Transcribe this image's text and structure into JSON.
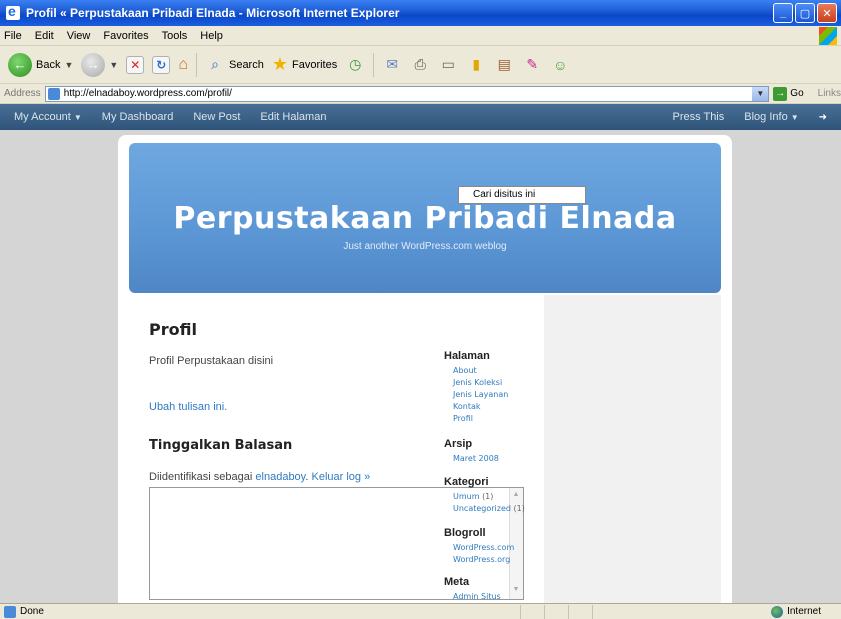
{
  "window": {
    "title": "Profil « Perpustakaan Pribadi Elnada - Microsoft Internet Explorer",
    "controls": {
      "minimize": "_",
      "maximize": "▢",
      "close": "✕"
    }
  },
  "menu": [
    "File",
    "Edit",
    "View",
    "Favorites",
    "Tools",
    "Help"
  ],
  "toolbar": {
    "back_label": "Back",
    "search_label": "Search",
    "favorites_label": "Favorites"
  },
  "address": {
    "label": "Address",
    "url": "http://elnadaboy.wordpress.com/profil/",
    "go_label": "Go",
    "links_label": "Links"
  },
  "wpbar": {
    "my_account": "My Account",
    "my_dashboard": "My Dashboard",
    "new_post": "New Post",
    "edit_halaman": "Edit Halaman",
    "press_this": "Press This",
    "blog_info": "Blog Info"
  },
  "blog": {
    "title": "Perpustakaan Pribadi Elnada",
    "tagline": "Just another WordPress.com weblog"
  },
  "post": {
    "title": "Profil",
    "body": "Profil Perpustakaan disini",
    "edit_link": "Ubah tulisan ini.",
    "reply_title": "Tinggalkan Balasan",
    "logged_prefix": "Diidentifikasi sebagai",
    "logged_user": "elnadaboy",
    "logout": "Keluar log »"
  },
  "sidebar": {
    "search_value": "Cari disitus ini",
    "halaman": {
      "heading": "Halaman",
      "items": [
        "About",
        "Jenis Koleksi",
        "Jenis Layanan",
        "Kontak",
        "Profil"
      ]
    },
    "arsip": {
      "heading": "Arsip",
      "items": [
        "Maret 2008"
      ]
    },
    "kategori": {
      "heading": "Kategori",
      "items": [
        {
          "label": "Umum",
          "count": "(1)"
        },
        {
          "label": "Uncategorized",
          "count": "(1)"
        }
      ]
    },
    "blogroll": {
      "heading": "Blogroll",
      "items": [
        "WordPress.com",
        "WordPress.org"
      ]
    },
    "meta": {
      "heading": "Meta",
      "items": [
        "Admin Situs"
      ]
    }
  },
  "status": {
    "left": "Done",
    "zone": "Internet"
  }
}
